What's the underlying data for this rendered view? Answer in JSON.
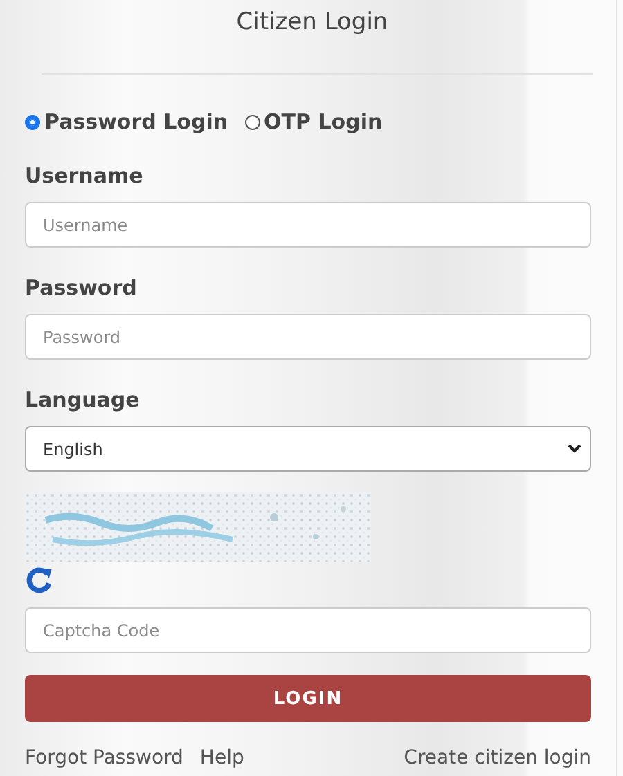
{
  "title": "Citizen Login",
  "login_modes": [
    {
      "label": "Password Login",
      "selected": true
    },
    {
      "label": "OTP Login",
      "selected": false
    }
  ],
  "fields": [
    {
      "kind": "text",
      "label": "Username",
      "placeholder": "Username"
    },
    {
      "kind": "password",
      "label": "Password",
      "placeholder": "Password"
    },
    {
      "kind": "select",
      "label": "Language",
      "value": "English"
    }
  ],
  "captcha": {
    "kind": "picture",
    "placeholder": "Captcha Code"
  },
  "login_button": "LOGIN",
  "links": {
    "left": [
      "Forgot Password",
      "Help"
    ],
    "right": [
      "Create citizen login"
    ]
  }
}
